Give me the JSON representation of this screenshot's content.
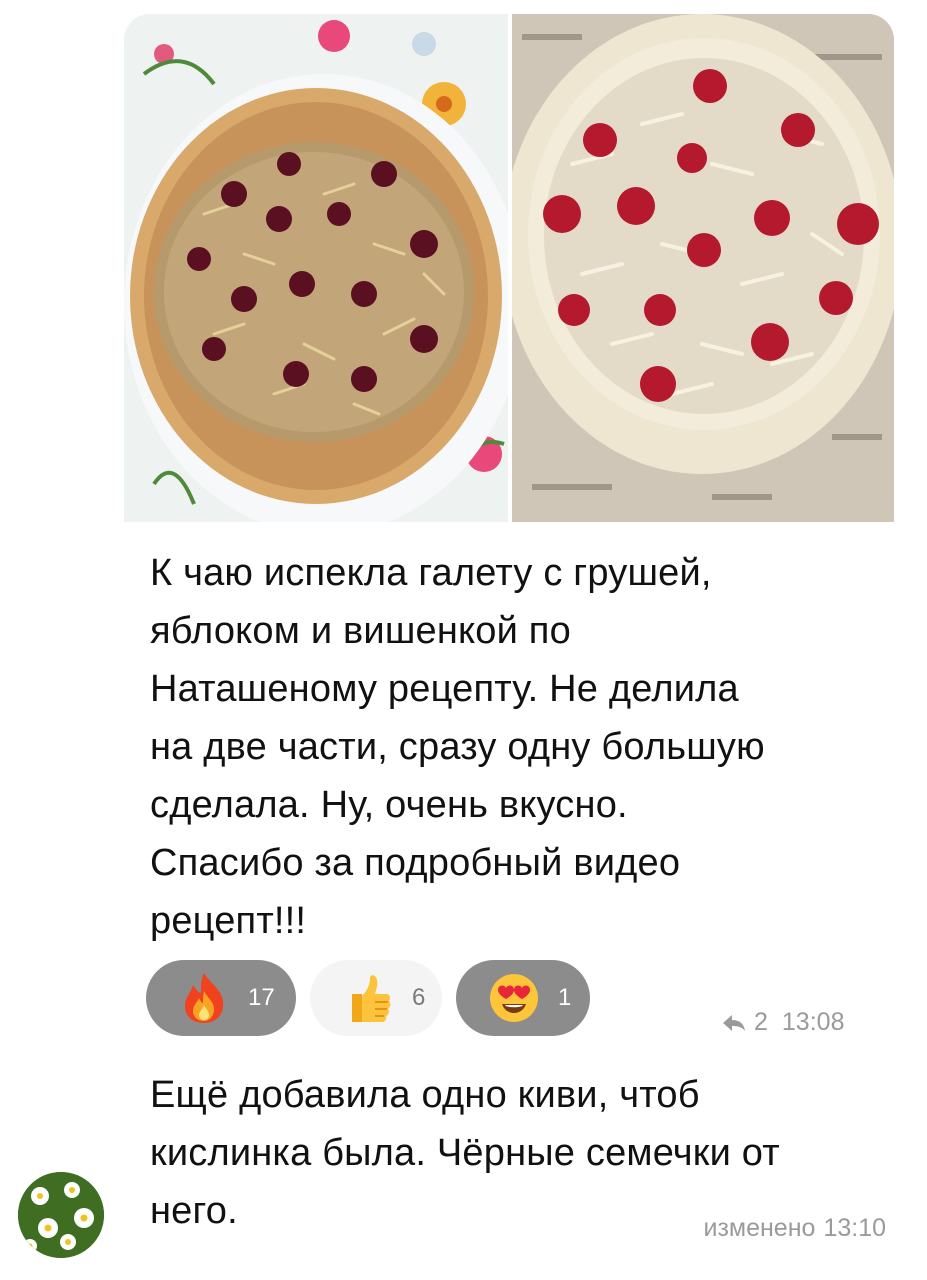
{
  "message1": {
    "text_lines": [
      "К чаю испекла галету с грушей,",
      "яблоком и вишенкой по",
      "Наташеному рецепту. Не делила",
      "на две части, сразу одну большую",
      "сделала. Ну, очень вкусно.",
      "Спасибо за подробный видео",
      "рецепт!!!"
    ],
    "photos": [
      {
        "icon": "baked-galette-photo"
      },
      {
        "icon": "raw-galette-photo"
      }
    ],
    "reactions": [
      {
        "icon": "fire-emoji",
        "count": "17",
        "active": true
      },
      {
        "icon": "thumbs-up-emoji",
        "count": "6",
        "active": false
      },
      {
        "icon": "heart-eyes-emoji",
        "count": "1",
        "active": true
      }
    ],
    "reply_count": "2",
    "time": "13:08"
  },
  "message2": {
    "text_lines": [
      "Ещё добавила одно киви, чтоб",
      "кислинка была. Чёрные семечки от",
      "него."
    ],
    "edited_label": "изменено",
    "time": "13:10"
  },
  "avatar": {
    "icon": "daisy-flowers-avatar"
  },
  "colors": {
    "bubble_bg": "#ffffff",
    "reaction_active": "#8c8c8c",
    "reaction_inactive": "#f4f4f4",
    "meta_text": "#9a9a9a"
  }
}
